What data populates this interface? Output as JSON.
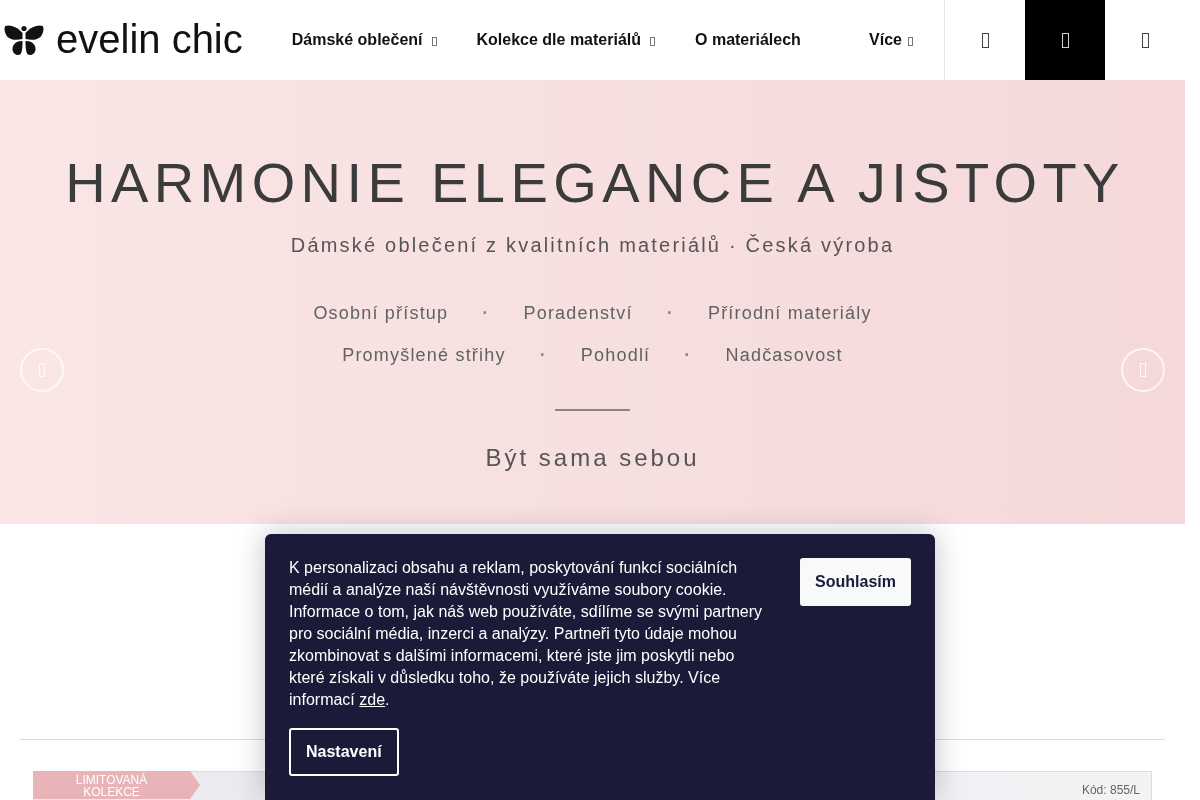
{
  "header": {
    "logo": {
      "text": "evelin chic"
    },
    "nav": [
      {
        "label": "Dámské oblečení",
        "has_dropdown": true
      },
      {
        "label": "Kolekce dle materiálů",
        "has_dropdown": true
      },
      {
        "label": "O materiálech",
        "has_dropdown": false
      },
      {
        "label": "Více",
        "has_dropdown": true
      }
    ],
    "icon_buttons": [
      {
        "selected": false
      },
      {
        "selected": true
      },
      {
        "selected": false
      }
    ]
  },
  "hero": {
    "title": "HARMONIE ELEGANCE A JISTOTY",
    "subtitle": "Dámské oblečení z kvalitních materiálů · Česká výroba",
    "feature_rows": [
      [
        {
          "kind": "feature",
          "text": "Osobní přístup"
        },
        {
          "kind": "separator",
          "text": "·"
        },
        {
          "kind": "feature",
          "text": "Poradenství"
        },
        {
          "kind": "separator",
          "text": "·"
        },
        {
          "kind": "feature",
          "text": "Přírodní materiály"
        }
      ],
      [
        {
          "kind": "feature",
          "text": "Promyšlené střihy"
        },
        {
          "kind": "separator",
          "text": "·"
        },
        {
          "kind": "feature",
          "text": "Pohodlí"
        },
        {
          "kind": "separator",
          "text": "·"
        },
        {
          "kind": "feature",
          "text": "Nadčasovost"
        }
      ]
    ],
    "tagline": "Být sama sebou"
  },
  "product": {
    "badge": "LIMITOVANÁ KOLEKCE",
    "code": "Kód: 855/L"
  },
  "cookie_banner": {
    "message": "K personalizaci obsahu a reklam, poskytování funkcí sociálních médií a analýze naší návštěvnosti využíváme soubory cookie. Informace o tom, jak náš web používáte, sdílíme se svými partnery pro sociální média, inzerci a analýzy. Partneři tyto údaje mohou zkombinovat s dalšími informacemi, které jste jim poskytli nebo které získali v důsledku toho, že používáte jejich služby. Více informací",
    "link": "zde",
    "message_end": ".",
    "buttons": [
      {
        "kind": "primary",
        "label": "Souhlasím"
      },
      {
        "kind": "outline",
        "label": "Nastavení"
      }
    ]
  }
}
